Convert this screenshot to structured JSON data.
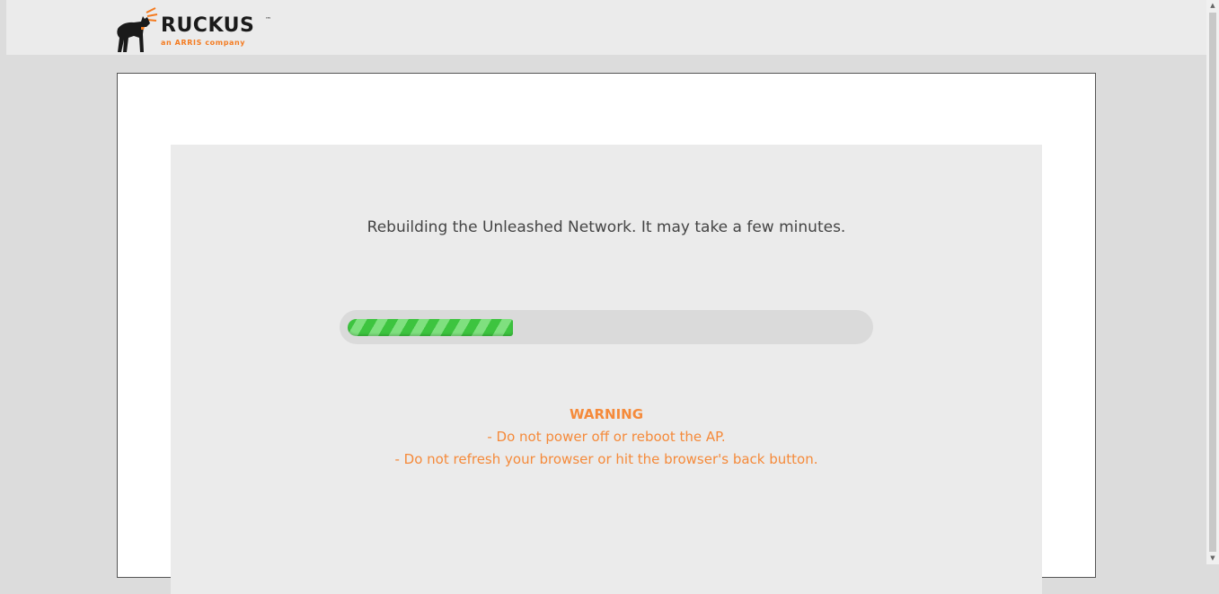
{
  "brand": {
    "name": "RUCKUS",
    "trademark": "™",
    "tagline": "an ARRIS company",
    "logo_icon": "dog-icon",
    "accent_color": "#f47b20"
  },
  "status": {
    "message": "Rebuilding the Unleashed Network. It may take a few minutes.",
    "progress_percent": 32,
    "progress_color": "#3dc43f"
  },
  "warning": {
    "title": "WARNING",
    "lines": [
      "- Do not power off or reboot the AP.",
      "- Do not refresh your browser or hit the browser's back button."
    ],
    "color": "#f58a3a"
  },
  "scrollbar": {
    "up_icon": "scroll-up-arrow-icon",
    "down_icon": "scroll-down-arrow-icon"
  }
}
